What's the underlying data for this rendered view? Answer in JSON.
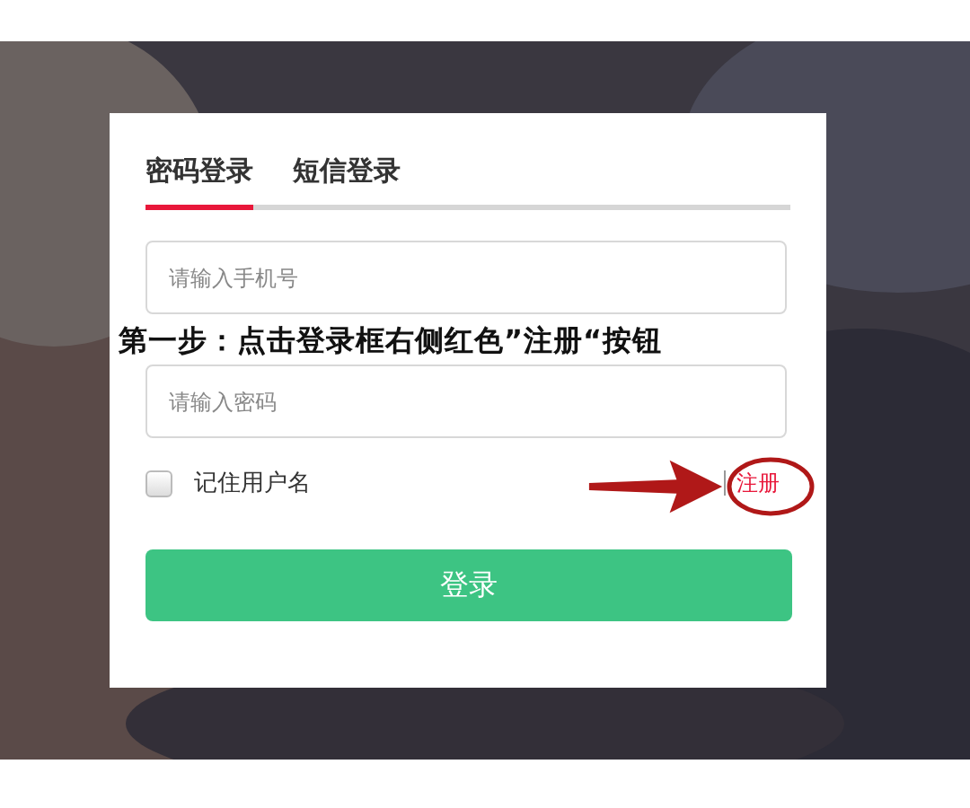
{
  "tabs": [
    {
      "label": "密码登录",
      "selected": true
    },
    {
      "label": "短信登录",
      "selected": false
    }
  ],
  "fields": [
    {
      "placeholder": "请输入手机号"
    },
    {
      "placeholder": "请输入密码"
    }
  ],
  "remember": {
    "label": "记住用户名",
    "checked": false
  },
  "links": [
    {
      "label": "注册",
      "kind": "highlight"
    }
  ],
  "login_button": "登录",
  "annotation": {
    "text": "第一步：点击登录框右侧红色”注册“按钮"
  }
}
